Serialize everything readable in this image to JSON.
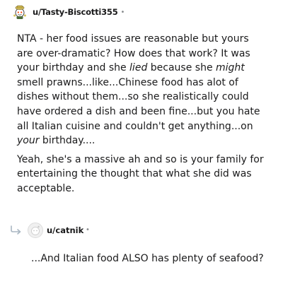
{
  "comment": {
    "username": "u/Tasty-Biscotti355",
    "separator": "•",
    "avatar_icon": "snoo-avatar-icon",
    "paragraph1": [
      {
        "text": "NTA - her food issues are reasonable but yours are over-dramatic? How does that work? It was your birthday and she "
      },
      {
        "text": "lied",
        "italic": true
      },
      {
        "text": " because she "
      },
      {
        "text": "might",
        "italic": true
      },
      {
        "text": " smell prawns...like...Chinese food has alot of dishes without them...so she realistically could have ordered a dish and been fine...but you hate all Italian cuisine and couldn't get anything...on "
      },
      {
        "text": "your",
        "italic": true
      },
      {
        "text": " birthday...."
      }
    ],
    "paragraph2": "Yeah, she's a massive ah and so is your family for entertaining the thought that what she did was acceptable."
  },
  "reply": {
    "username": "u/catnik",
    "separator": "•",
    "avatar_icon": "default-avatar-icon",
    "arrow_icon": "reply-arrow-icon",
    "text": "...And Italian food ALSO has plenty of seafood?"
  },
  "colors": {
    "text": "#1a1a1b",
    "muted": "#878a8c",
    "arrow": "#a9b6c2"
  }
}
